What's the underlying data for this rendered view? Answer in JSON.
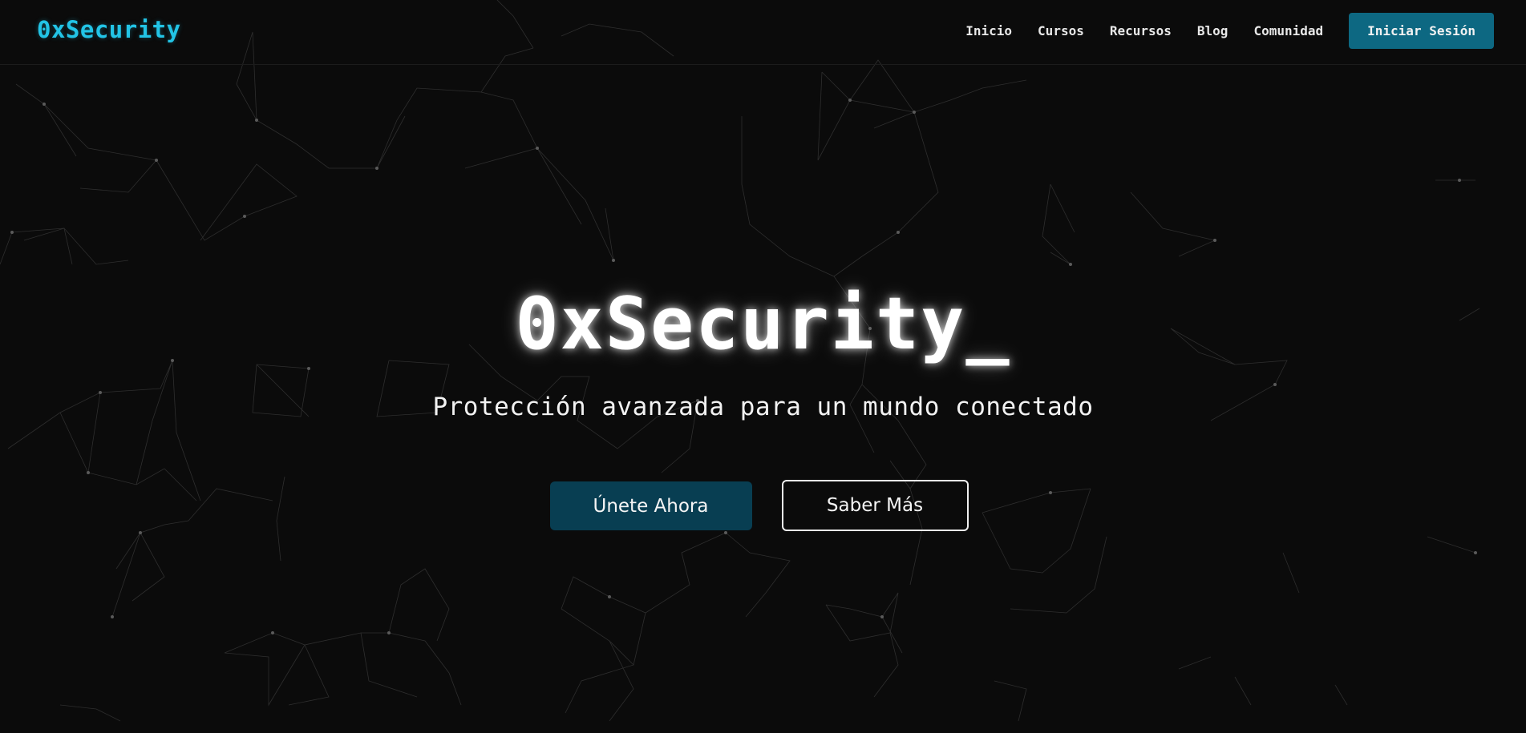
{
  "header": {
    "logo": "0xSecurity",
    "nav": [
      "Inicio",
      "Cursos",
      "Recursos",
      "Blog",
      "Comunidad"
    ],
    "login_label": "Iniciar Sesión"
  },
  "hero": {
    "title": "0xSecurity_",
    "subtitle": "Protección avanzada para un mundo conectado",
    "primary_button": "Únete Ahora",
    "secondary_button": "Saber Más"
  },
  "colors": {
    "background": "#0b0b0b",
    "accent": "#22c4e6",
    "login_button": "#0d6882",
    "primary_button": "#083e52",
    "text": "#ffffff"
  }
}
